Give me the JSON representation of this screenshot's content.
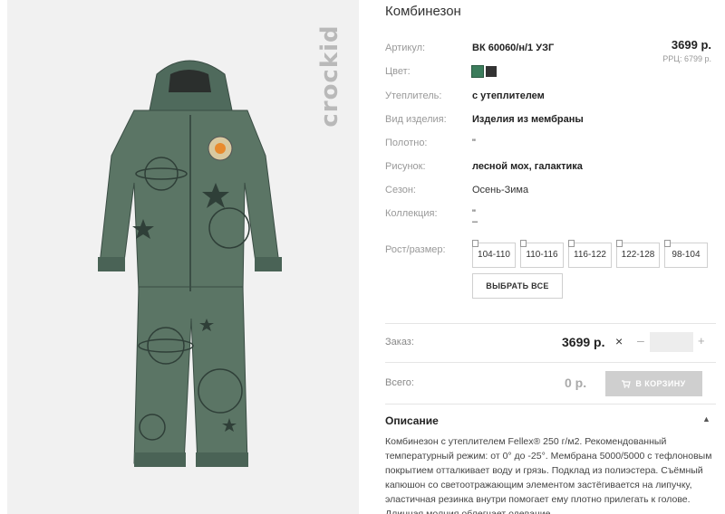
{
  "product": {
    "title": "Комбинезон",
    "price": "3699 р.",
    "rrp": "РРЦ: 6799 р."
  },
  "brand": {
    "logo_text": "crockid"
  },
  "attributes": {
    "article_label": "Артикул:",
    "article_value": "ВК 60060/н/1 УЗГ",
    "color_label": "Цвет:",
    "colors": [
      "#3c7d5c",
      "#333333"
    ],
    "insulation_label": "Утеплитель:",
    "insulation_value": "с утеплителем",
    "type_label": "Вид изделия:",
    "type_value": "Изделия из мембраны",
    "fabric_label": "Полотно:",
    "fabric_value": "\"",
    "pattern_label": "Рисунок:",
    "pattern_value": "лесной мох, галактика",
    "season_label": "Сезон:",
    "season_value": "Осень-Зима",
    "collection_label": "Коллекция:",
    "collection_value_1": "\"",
    "collection_value_2": "–"
  },
  "sizes": {
    "label": "Рост/размер:",
    "items": [
      "104-110",
      "110-116",
      "116-122",
      "122-128",
      "98-104"
    ],
    "select_all": "ВЫБРАТЬ ВСЕ"
  },
  "order": {
    "label": "Заказ:",
    "price": "3699 р.",
    "times": "×",
    "minus": "–",
    "plus": "+",
    "qty_value": ""
  },
  "total": {
    "label": "Всего:",
    "value": "0 р.",
    "cart_button": "В КОРЗИНУ"
  },
  "description": {
    "title": "Описание",
    "text": "Комбинезон с утеплителем Fellex® 250 г/м2. Рекомендованный температурный режим: от 0° до -25°. Мембрана 5000/5000 с тефлоновым покрытием отталкивает воду и грязь. Подклад из полиэстера. Съёмный капюшон со светоотражающим элементом застёгивается на липучку, эластичная резинка внутри помогает ему плотно прилегать к голове. Длинная молния облегчает одевание."
  },
  "icons": {
    "cart": "cart-icon",
    "collapse": "caret-up-icon",
    "logo": "crockid-logo"
  }
}
